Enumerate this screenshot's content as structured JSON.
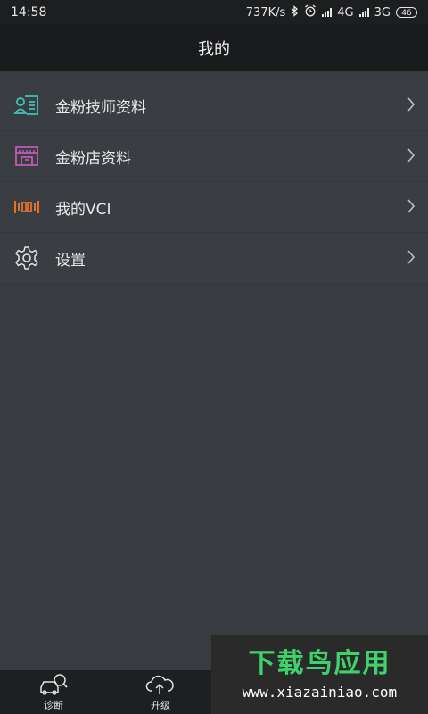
{
  "status_bar": {
    "time": "14:58",
    "speed": "737K/s",
    "network1": "4G",
    "network2": "3G",
    "battery": "46",
    "bluetooth_icon": "bluetooth-icon",
    "alarm_icon": "alarm-icon"
  },
  "header": {
    "title": "我的"
  },
  "menu": {
    "items": [
      {
        "label": "金粉技师资料",
        "icon": "technician-card-icon",
        "color": "#3fc3b8"
      },
      {
        "label": "金粉店资料",
        "icon": "store-icon",
        "color": "#c25bb8"
      },
      {
        "label": "我的VCI",
        "icon": "vci-device-icon",
        "color": "#e0742a"
      },
      {
        "label": "设置",
        "icon": "gear-icon",
        "color": "#e6e6e6"
      }
    ]
  },
  "tabs": [
    {
      "label": "诊断",
      "icon": "car-search-icon"
    },
    {
      "label": "升级",
      "icon": "cloud-upgrade-icon"
    }
  ],
  "watermark": {
    "title": "下载鸟应用",
    "url": "www.xiazainiao.com"
  }
}
